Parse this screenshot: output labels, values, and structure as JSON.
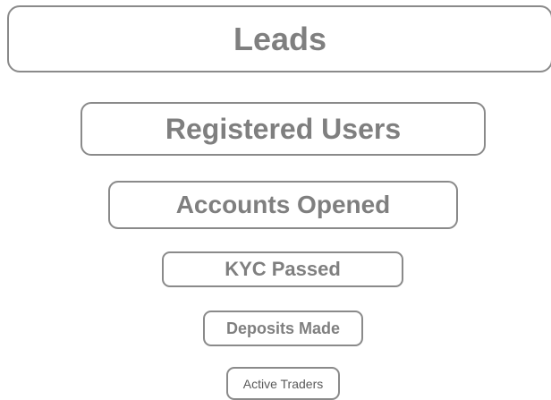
{
  "funnel": {
    "stages": [
      {
        "label": "Leads"
      },
      {
        "label": "Registered Users"
      },
      {
        "label": "Accounts Opened"
      },
      {
        "label": "KYC Passed"
      },
      {
        "label": "Deposits Made"
      },
      {
        "label": "Active Traders"
      }
    ]
  }
}
